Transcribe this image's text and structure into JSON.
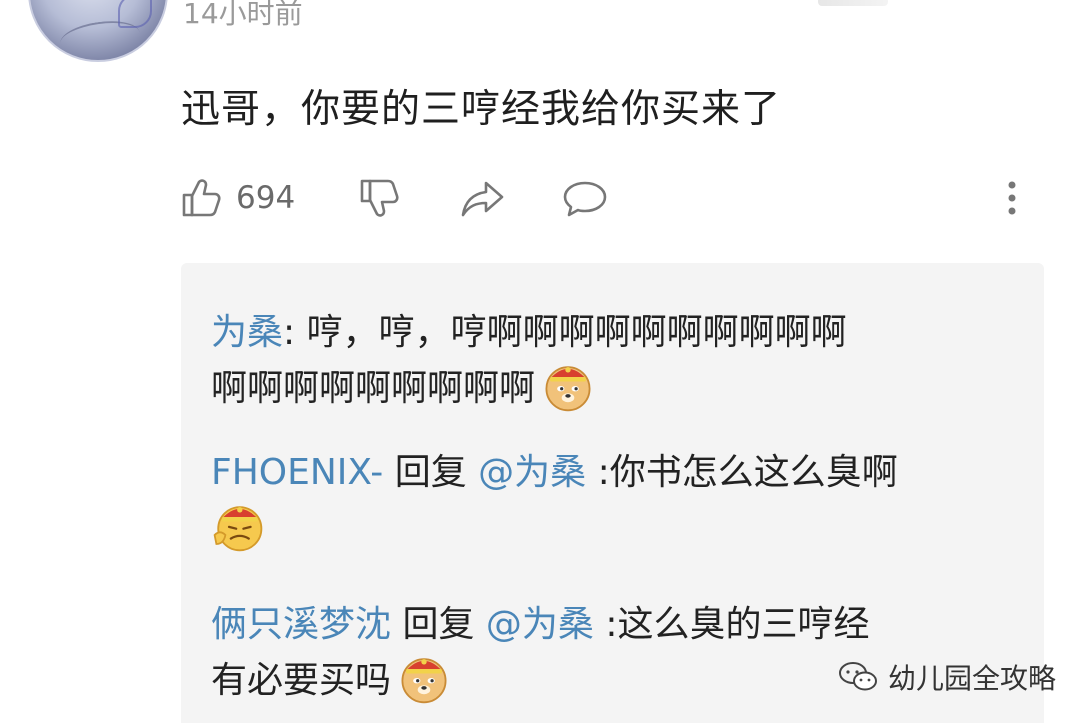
{
  "comment": {
    "timestamp": "14小时前",
    "text": "迅哥，你要的三哼经我给你买来了",
    "like_count": "694"
  },
  "icons": {
    "like": "thumbs-up-icon",
    "dislike": "thumbs-down-icon",
    "share": "share-icon",
    "comment": "comment-bubble-icon",
    "more": "more-vertical-icon",
    "doge": "doge-emoji-icon",
    "sneer": "sneer-emoji-icon",
    "watermark": "wechat-icon"
  },
  "replies": [
    {
      "user": "为桑",
      "separator": ": ",
      "text_line1": "哼，哼，哼啊啊啊啊啊啊啊啊啊啊",
      "text_line2": "啊啊啊啊啊啊啊啊啊"
    },
    {
      "user": "FHOENIX-",
      "reply_word": " 回复 ",
      "mention": "@为桑",
      "text": " :你书怎么这么臭啊"
    },
    {
      "user": "俩只溪梦沈",
      "reply_word": " 回复 ",
      "mention": "@为桑",
      "text_line1": " :这么臭的三哼经",
      "text_line2": "有必要买吗"
    }
  ],
  "watermark": {
    "text": "幼儿园全攻略"
  },
  "colors": {
    "username": "#4a86b8",
    "reply_bg": "#f4f4f4",
    "meta_gray": "#9a9a9a"
  }
}
